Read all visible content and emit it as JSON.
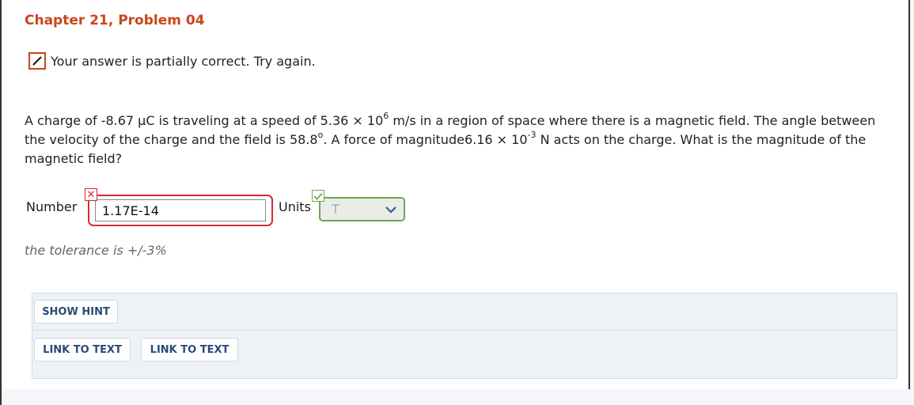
{
  "problem": {
    "title": "Chapter 21, Problem 04",
    "status_message": "Your answer is partially correct.  Try again.",
    "question": {
      "part1": "A charge of -8.67 μC is traveling at a speed of 5.36 × 10",
      "exp1": "6",
      "part2": " m/s in a region of space where there is a magnetic field. The angle between the velocity of the charge and the field is 58.8",
      "exp2": "o",
      "part3": ". A force of magnitude6.16 × 10",
      "exp3": "-3",
      "part4": " N acts on the charge. What is the magnitude of the magnetic field?"
    }
  },
  "answer": {
    "number_label": "Number",
    "number_value": "1.17E-14",
    "number_status": "incorrect",
    "units_label": "Units",
    "units_value": "T",
    "units_status": "correct"
  },
  "tolerance_text": "the tolerance is +/-3%",
  "buttons": {
    "show_hint": "SHOW HINT",
    "link_to_text_1": "LINK TO TEXT",
    "link_to_text_2": "LINK TO TEXT"
  },
  "colors": {
    "accent": "#c8461c",
    "error": "#d62c2c",
    "success": "#6aa84f",
    "link": "#2b4a76"
  }
}
